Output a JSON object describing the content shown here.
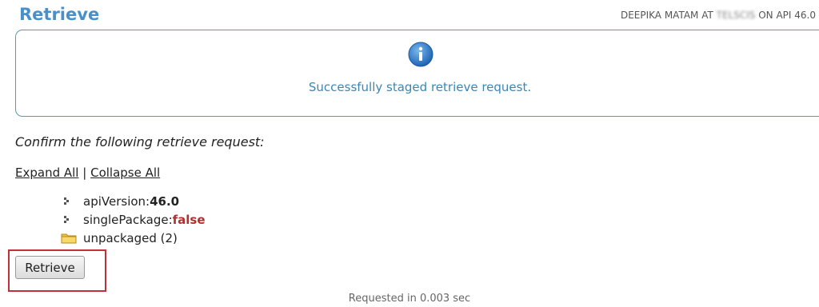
{
  "page": {
    "title": "Retrieve",
    "user_prefix": "DEEPIKA MATAM AT",
    "user_org_redacted": "TELSCIS",
    "user_suffix": "ON API 46.0"
  },
  "message": {
    "icon": "info-icon",
    "text": "Successfully staged retrieve request."
  },
  "confirm": {
    "heading": "Confirm the following retrieve request:"
  },
  "tree_controls": {
    "expand_all": "Expand All",
    "separator": "|",
    "collapse_all": "Collapse All"
  },
  "tree": {
    "items": [
      {
        "label": "apiVersion: ",
        "value": "46.0",
        "icon": "bullet-icon"
      },
      {
        "label": "singlePackage: ",
        "value": "false",
        "icon": "bullet-icon"
      },
      {
        "label": "unpackaged (2)",
        "icon": "folder-icon"
      }
    ]
  },
  "actions": {
    "retrieve_label": "Retrieve"
  },
  "footer": {
    "text": "Requested in 0.003 sec"
  },
  "colors": {
    "title": "#4a90c8",
    "message_text": "#3a87b5",
    "message_border": "#4ea0b0",
    "false_value": "#b03030",
    "highlight_frame": "#c0303a"
  }
}
